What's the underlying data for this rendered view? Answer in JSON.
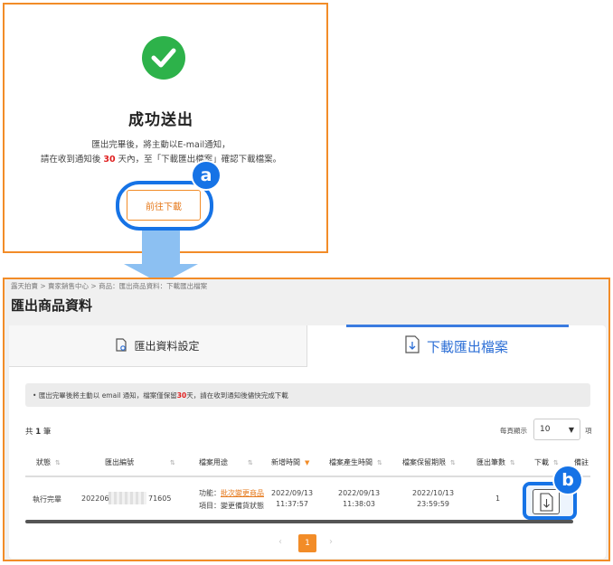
{
  "dialog": {
    "title": "成功送出",
    "line1": "匯出完畢後，將主動以E-mail通知，",
    "line2_pre": "請在收到通知後 ",
    "line2_days": "30",
    "line2_post": " 天內，至「下載匯出檔案」確認下載檔案。",
    "button_label": "前往下載",
    "callout": "a",
    "colors": {
      "accent": "#f28c28",
      "success": "#2db24a",
      "callout": "#1673e6"
    }
  },
  "panel": {
    "breadcrumb": "露天拍賣 > 賣家銷售中心 > 商品：匯出商品資料：下載匯出檔案",
    "page_title": "匯出商品資料",
    "tabs": [
      {
        "label": "匯出資料設定",
        "icon": "file-settings-icon"
      },
      {
        "label": "下載匯出檔案",
        "icon": "file-download-icon"
      }
    ],
    "notice_pre": "匯出完畢後將主動以 email 通知，檔案僅保留 ",
    "notice_days": "30",
    "notice_post": " 天，請在收到通知後儘快完成下載",
    "total_pre": "共 ",
    "total_count": "1",
    "total_post": " 筆",
    "per_page_label": "每頁顯示",
    "per_page_value": "10",
    "per_page_unit": "項",
    "table": {
      "headers": [
        "狀態",
        "匯出編號",
        "檔案用途",
        "新增時間",
        "檔案產生時間",
        "檔案保留期限",
        "匯出筆數",
        "下載",
        "備註"
      ],
      "row": {
        "status": "執行完畢",
        "export_id_start": "202206",
        "export_id_end": "71605",
        "purpose_prefix1": "功能：",
        "purpose_link": "批次變更商品",
        "purpose_line2": "項目：變更備貨狀態",
        "created_date": "2022/09/13",
        "created_time": "11:37:57",
        "generated_date": "2022/09/13",
        "generated_time": "11:38:03",
        "expiry_date": "2022/10/13",
        "expiry_time": "23:59:59",
        "count": "1"
      }
    },
    "callout": "b",
    "pager": {
      "prev": "‹",
      "current": "1",
      "next": "›"
    }
  }
}
